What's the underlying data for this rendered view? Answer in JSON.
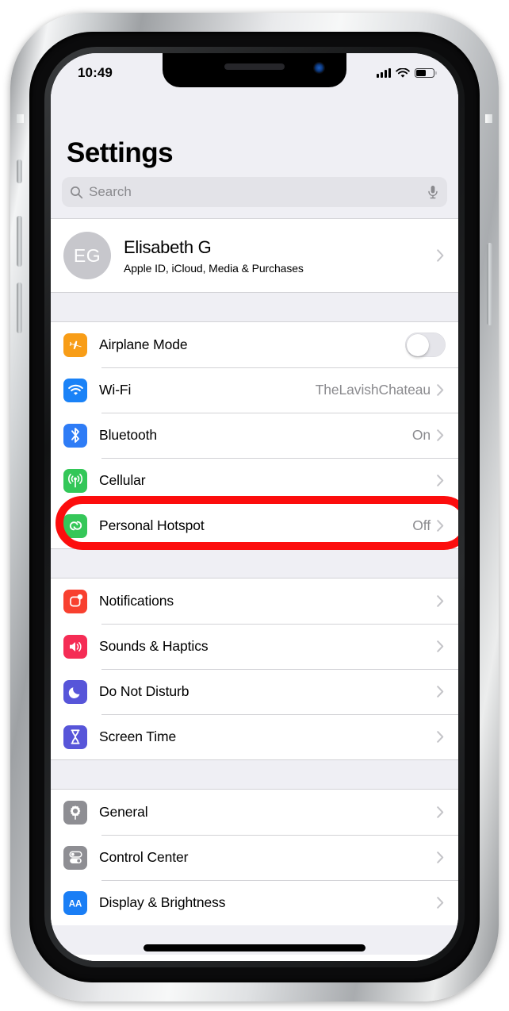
{
  "status_bar": {
    "time": "10:49",
    "cellular_icon": "signal-bars-icon",
    "wifi_icon": "wifi-icon",
    "battery_icon": "battery-icon"
  },
  "header": {
    "title": "Settings"
  },
  "search": {
    "placeholder": "Search",
    "search_icon": "search-icon",
    "mic_icon": "microphone-icon"
  },
  "profile": {
    "initials": "EG",
    "name": "Elisabeth G",
    "subtitle": "Apple ID, iCloud, Media & Purchases"
  },
  "annotation": {
    "color": "#fc0d0d",
    "target": "Bluetooth"
  },
  "groups": [
    {
      "id": "connectivity",
      "rows": [
        {
          "label": "Airplane Mode",
          "icon": "airplane-icon",
          "icon_color": "#f89d17",
          "control": "toggle",
          "toggle_on": false
        },
        {
          "label": "Wi-Fi",
          "icon": "wifi-icon",
          "icon_color": "#1a82f7",
          "value": "TheLavishChateau",
          "control": "chevron"
        },
        {
          "label": "Bluetooth",
          "icon": "bluetooth-icon",
          "icon_color": "#2e7cf6",
          "value": "On",
          "control": "chevron",
          "highlighted": true
        },
        {
          "label": "Cellular",
          "icon": "cellular-antenna-icon",
          "icon_color": "#33c758",
          "value": "",
          "control": "chevron"
        },
        {
          "label": "Personal Hotspot",
          "icon": "hotspot-link-icon",
          "icon_color": "#35c759",
          "value": "Off",
          "control": "chevron"
        }
      ]
    },
    {
      "id": "alerts",
      "rows": [
        {
          "label": "Notifications",
          "icon": "notifications-icon",
          "icon_color": "#f8402f",
          "value": "",
          "control": "chevron"
        },
        {
          "label": "Sounds & Haptics",
          "icon": "speaker-icon",
          "icon_color": "#f52c55",
          "value": "",
          "control": "chevron"
        },
        {
          "label": "Do Not Disturb",
          "icon": "moon-icon",
          "icon_color": "#5755d9",
          "value": "",
          "control": "chevron"
        },
        {
          "label": "Screen Time",
          "icon": "hourglass-icon",
          "icon_color": "#5755d9",
          "value": "",
          "control": "chevron"
        }
      ]
    },
    {
      "id": "system",
      "rows": [
        {
          "label": "General",
          "icon": "gear-icon",
          "icon_color": "#8e8e93",
          "value": "",
          "control": "chevron"
        },
        {
          "label": "Control Center",
          "icon": "control-center-icon",
          "icon_color": "#8e8e93",
          "value": "",
          "control": "chevron"
        },
        {
          "label": "Display & Brightness",
          "icon": "display-aa-icon",
          "icon_color": "#1a7ef5",
          "value": "",
          "control": "chevron"
        }
      ]
    }
  ]
}
